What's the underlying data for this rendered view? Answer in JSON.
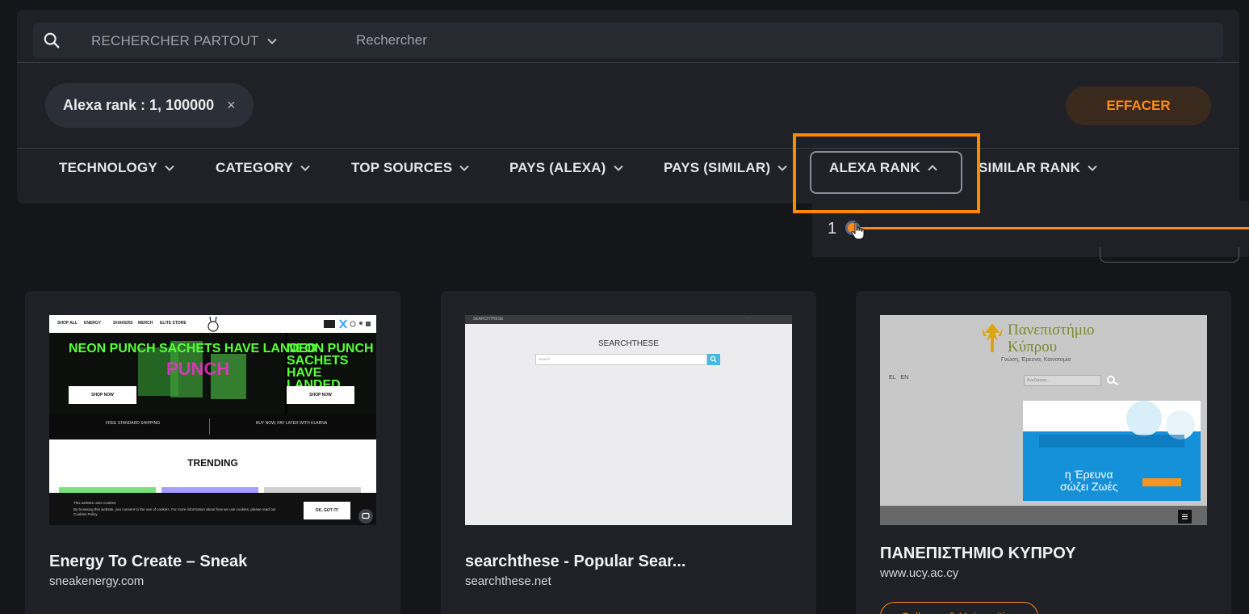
{
  "search": {
    "scope_label": "RECHERCHER PARTOUT",
    "placeholder": "Rechercher"
  },
  "active_filter": {
    "label": "Alexa rank : 1, 100000",
    "close": "×"
  },
  "clear_label": "EFFACER",
  "filters": [
    {
      "label": "TECHNOLOGY"
    },
    {
      "label": "CATEGORY"
    },
    {
      "label": "TOP SOURCES"
    },
    {
      "label": "PAYS (ALEXA)"
    },
    {
      "label": "PAYS (SIMILAR)"
    },
    {
      "label": "ALEXA RANK",
      "expanded": true
    },
    {
      "label": "SIMILAR RANK"
    }
  ],
  "alexa_dropdown": {
    "min_value": "1"
  },
  "cards": [
    {
      "title": "Energy To Create – Sneak",
      "domain": "sneakenergy.com",
      "thumb": {
        "nav": [
          "SHOP ALL",
          "ENERGY",
          "SHAKERS",
          "MERCH",
          "ELITE STORE"
        ],
        "headline": "NEON PUNCH SACHETS HAVE LANDED",
        "shop_now": "SHOP NOW",
        "shipping": "FREE STANDARD SHIPPING",
        "klarna": "BUY NOW, PAY LATER WITH KLARNA",
        "trending": "TRENDING",
        "cookie_title": "This website uses cookies.",
        "cookie_text": "By browsing this website, you consent to the use of cookies. For more information about how we use cookies, please read our Cookies Policy.",
        "cookie_btn": "OK, GOT IT!"
      }
    },
    {
      "title": "searchthese - Popular Sear...",
      "domain": "searchthese.net",
      "thumb": {
        "top_brand": "SEARCHTHESE",
        "brand": "SEARCHTHESE",
        "search_placeholder": "Search"
      }
    },
    {
      "title": "ΠΑΝΕΠΙΣΤΗΜΙΟ ΚΥΠΡΟΥ",
      "domain": "www.ucy.ac.cy",
      "tag": "Colleges & Universities",
      "thumb": {
        "logo_line1": "Πανεπιστήμιο",
        "logo_line2": "Κύπρου",
        "motto": "Γνώση, Έρευνα, Καινοτομία",
        "lang_el": "EL",
        "lang_en": "EN",
        "search_placeholder": "Αναζήτηση...",
        "banner_line1": "η Έρευνα",
        "banner_line2": "σώζει Ζωές"
      }
    }
  ],
  "colors": {
    "accent": "#ff8a1c",
    "background": "#15161a",
    "panel": "#1f2127"
  }
}
